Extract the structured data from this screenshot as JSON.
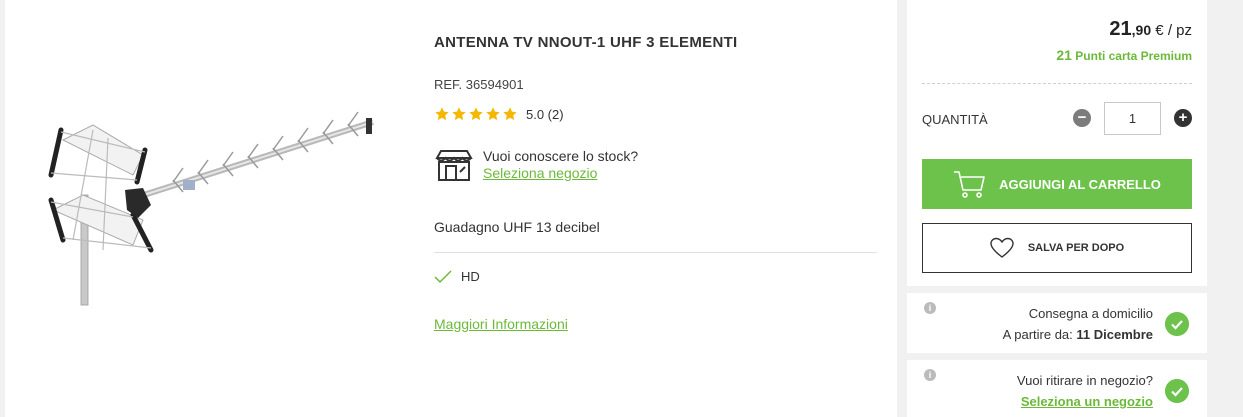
{
  "product": {
    "title": "ANTENNA TV NNOUT-1 UHF 3 ELEMENTI",
    "ref": "REF. 36594901",
    "rating_text": "5.0 (2)",
    "rating_value": 5,
    "stock_question": "Vuoi conoscere lo stock?",
    "stock_link": "Seleziona negozio",
    "feature": "Guadagno UHF 13 decibel",
    "hd_label": "HD",
    "more_info": "Maggiori Informazioni"
  },
  "purchase": {
    "price_int": "21",
    "price_dec": ",90",
    "price_unit": " € / pz",
    "points_number": "21",
    "points_label": " Punti carta Premium",
    "quantity_label": "QUANTITÀ",
    "quantity_value": "1",
    "add_to_cart": "AGGIUNGI AL CARRELLO",
    "save_later": "SALVA PER DOPO"
  },
  "delivery": {
    "home_title": "Consegna a domicilio",
    "home_from_prefix": "A partire da: ",
    "home_date": "11 Dicembre",
    "pickup_question": "Vuoi ritirare in negozio?",
    "pickup_link": "Seleziona un negozio"
  },
  "colors": {
    "accent": "#6cc24a",
    "link": "#6cb93a",
    "star": "#f5b800"
  }
}
